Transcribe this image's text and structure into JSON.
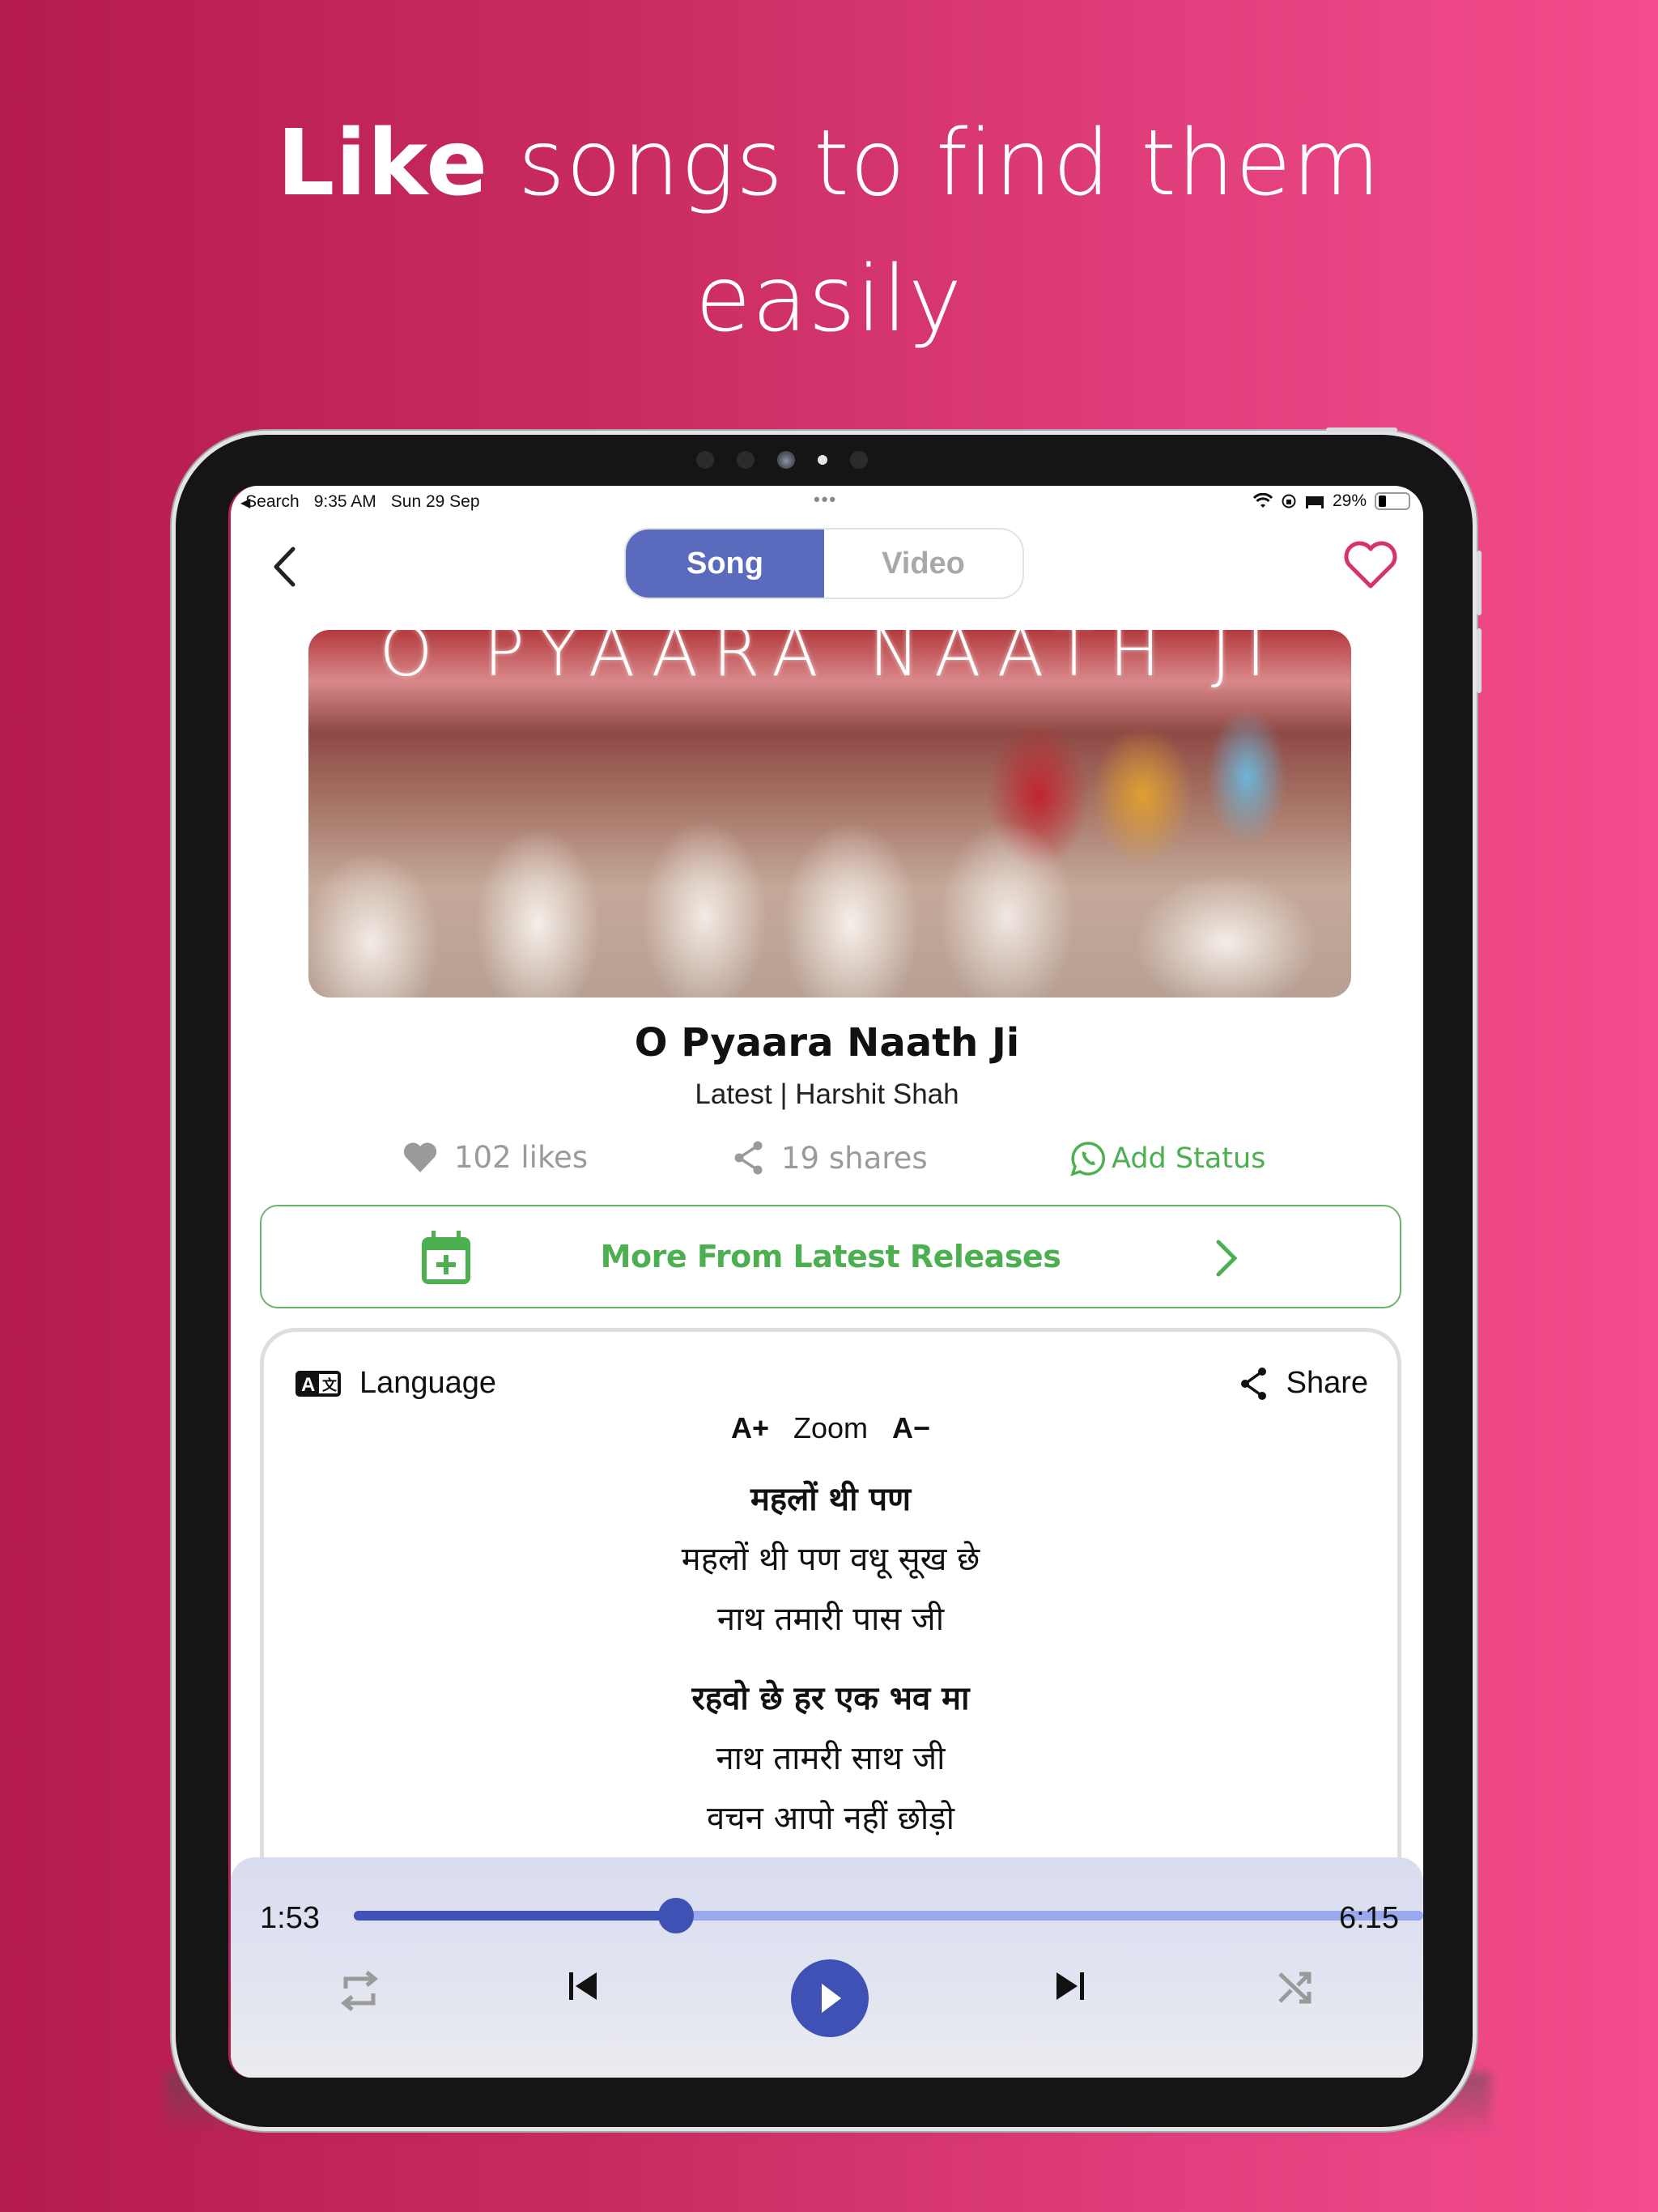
{
  "headline": {
    "bold": "Like",
    "rest": " songs to find them",
    "line2": "easily"
  },
  "status_bar": {
    "back_label": "Search",
    "time": "9:35 AM",
    "date": "Sun 29 Sep",
    "center": "•••",
    "battery": "29%",
    "icons": [
      "wifi-icon",
      "orientation-lock-icon",
      "sleep-mode-icon",
      "battery-icon"
    ]
  },
  "nav": {
    "tabs": [
      {
        "label": "Song",
        "active": true
      },
      {
        "label": "Video",
        "active": false
      }
    ],
    "favorite_active": false
  },
  "thumbnail": {
    "overlay_text": "O PYAARA NAATH JI"
  },
  "song": {
    "title": "O Pyaara Naath Ji",
    "subtitle": "Latest | Harshit Shah",
    "likes": "102 likes",
    "shares": "19 shares",
    "add_status": "Add Status"
  },
  "more_button": {
    "label": "More From Latest Releases"
  },
  "lyrics_card": {
    "language_label": "Language",
    "share_label": "Share",
    "zoom_in": "A+",
    "zoom_label": "Zoom",
    "zoom_out": "A−",
    "stanzas": [
      {
        "heading": "महलों थी पण",
        "lines": [
          "महलों थी पण वधू सूख छे",
          "नाथ तमारी पास जी"
        ]
      },
      {
        "heading": "रहवो छे हर एक भव मा",
        "lines": [
          "नाथ तामरी साथ जी",
          "वचन आपो नहीं छोड़ो"
        ]
      }
    ]
  },
  "player": {
    "current_time": "1:53",
    "total_time": "6:15",
    "progress": 0.301,
    "playing": false
  },
  "colors": {
    "accent": "#3f51b5",
    "segment_active": "#5a6bbd",
    "green": "#4caf50",
    "heart": "#d6336c",
    "bg_left": "#b51c4e",
    "bg_right": "#f44c8c"
  }
}
